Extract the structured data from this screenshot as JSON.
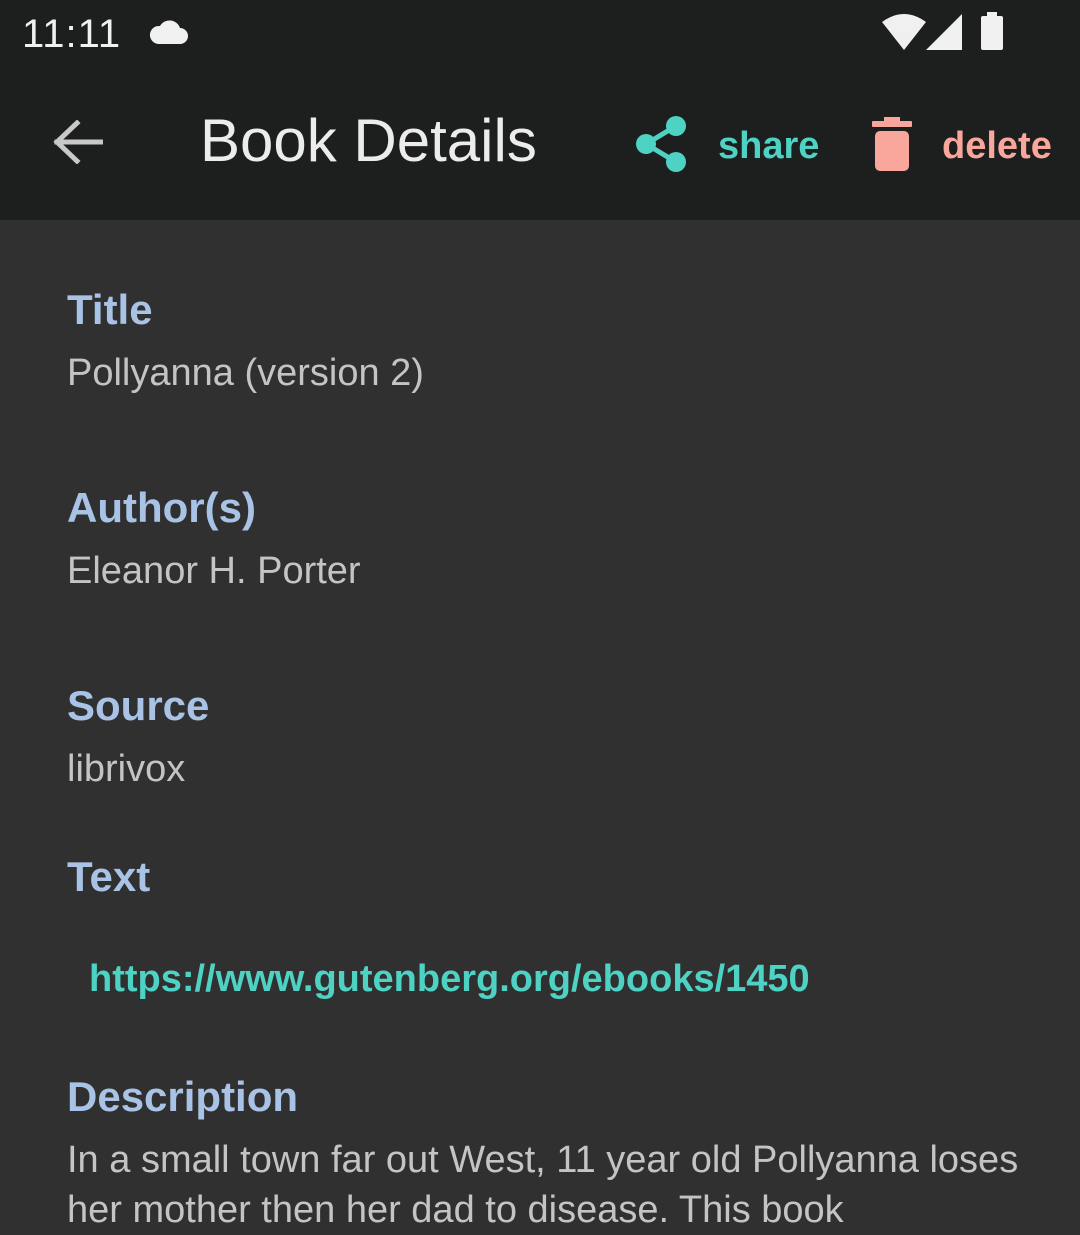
{
  "status_bar": {
    "time": "11:11"
  },
  "app_bar": {
    "title": "Book Details",
    "share_label": "share",
    "delete_label": "delete"
  },
  "fields": {
    "title_label": "Title",
    "title_value": "Pollyanna (version 2)",
    "author_label": "Author(s)",
    "author_value": "Eleanor H. Porter",
    "source_label": "Source",
    "source_value": "librivox",
    "text_label": "Text",
    "text_link": "https://www.gutenberg.org/ebooks/1450",
    "description_label": "Description",
    "description_value": "In a small town far out West, 11 year old Pollyanna loses her mother then her dad to disease.  This book"
  },
  "colors": {
    "bar_background": "#1d1e1e",
    "content_background": "#303030",
    "accent_share": "#4dd2c3",
    "accent_delete": "#f9a79c",
    "label_color": "#a9c3e6"
  },
  "icons": [
    "cloud-icon",
    "wifi-icon",
    "signal-icon",
    "battery-icon",
    "back-arrow-icon",
    "share-icon",
    "delete-icon"
  ]
}
